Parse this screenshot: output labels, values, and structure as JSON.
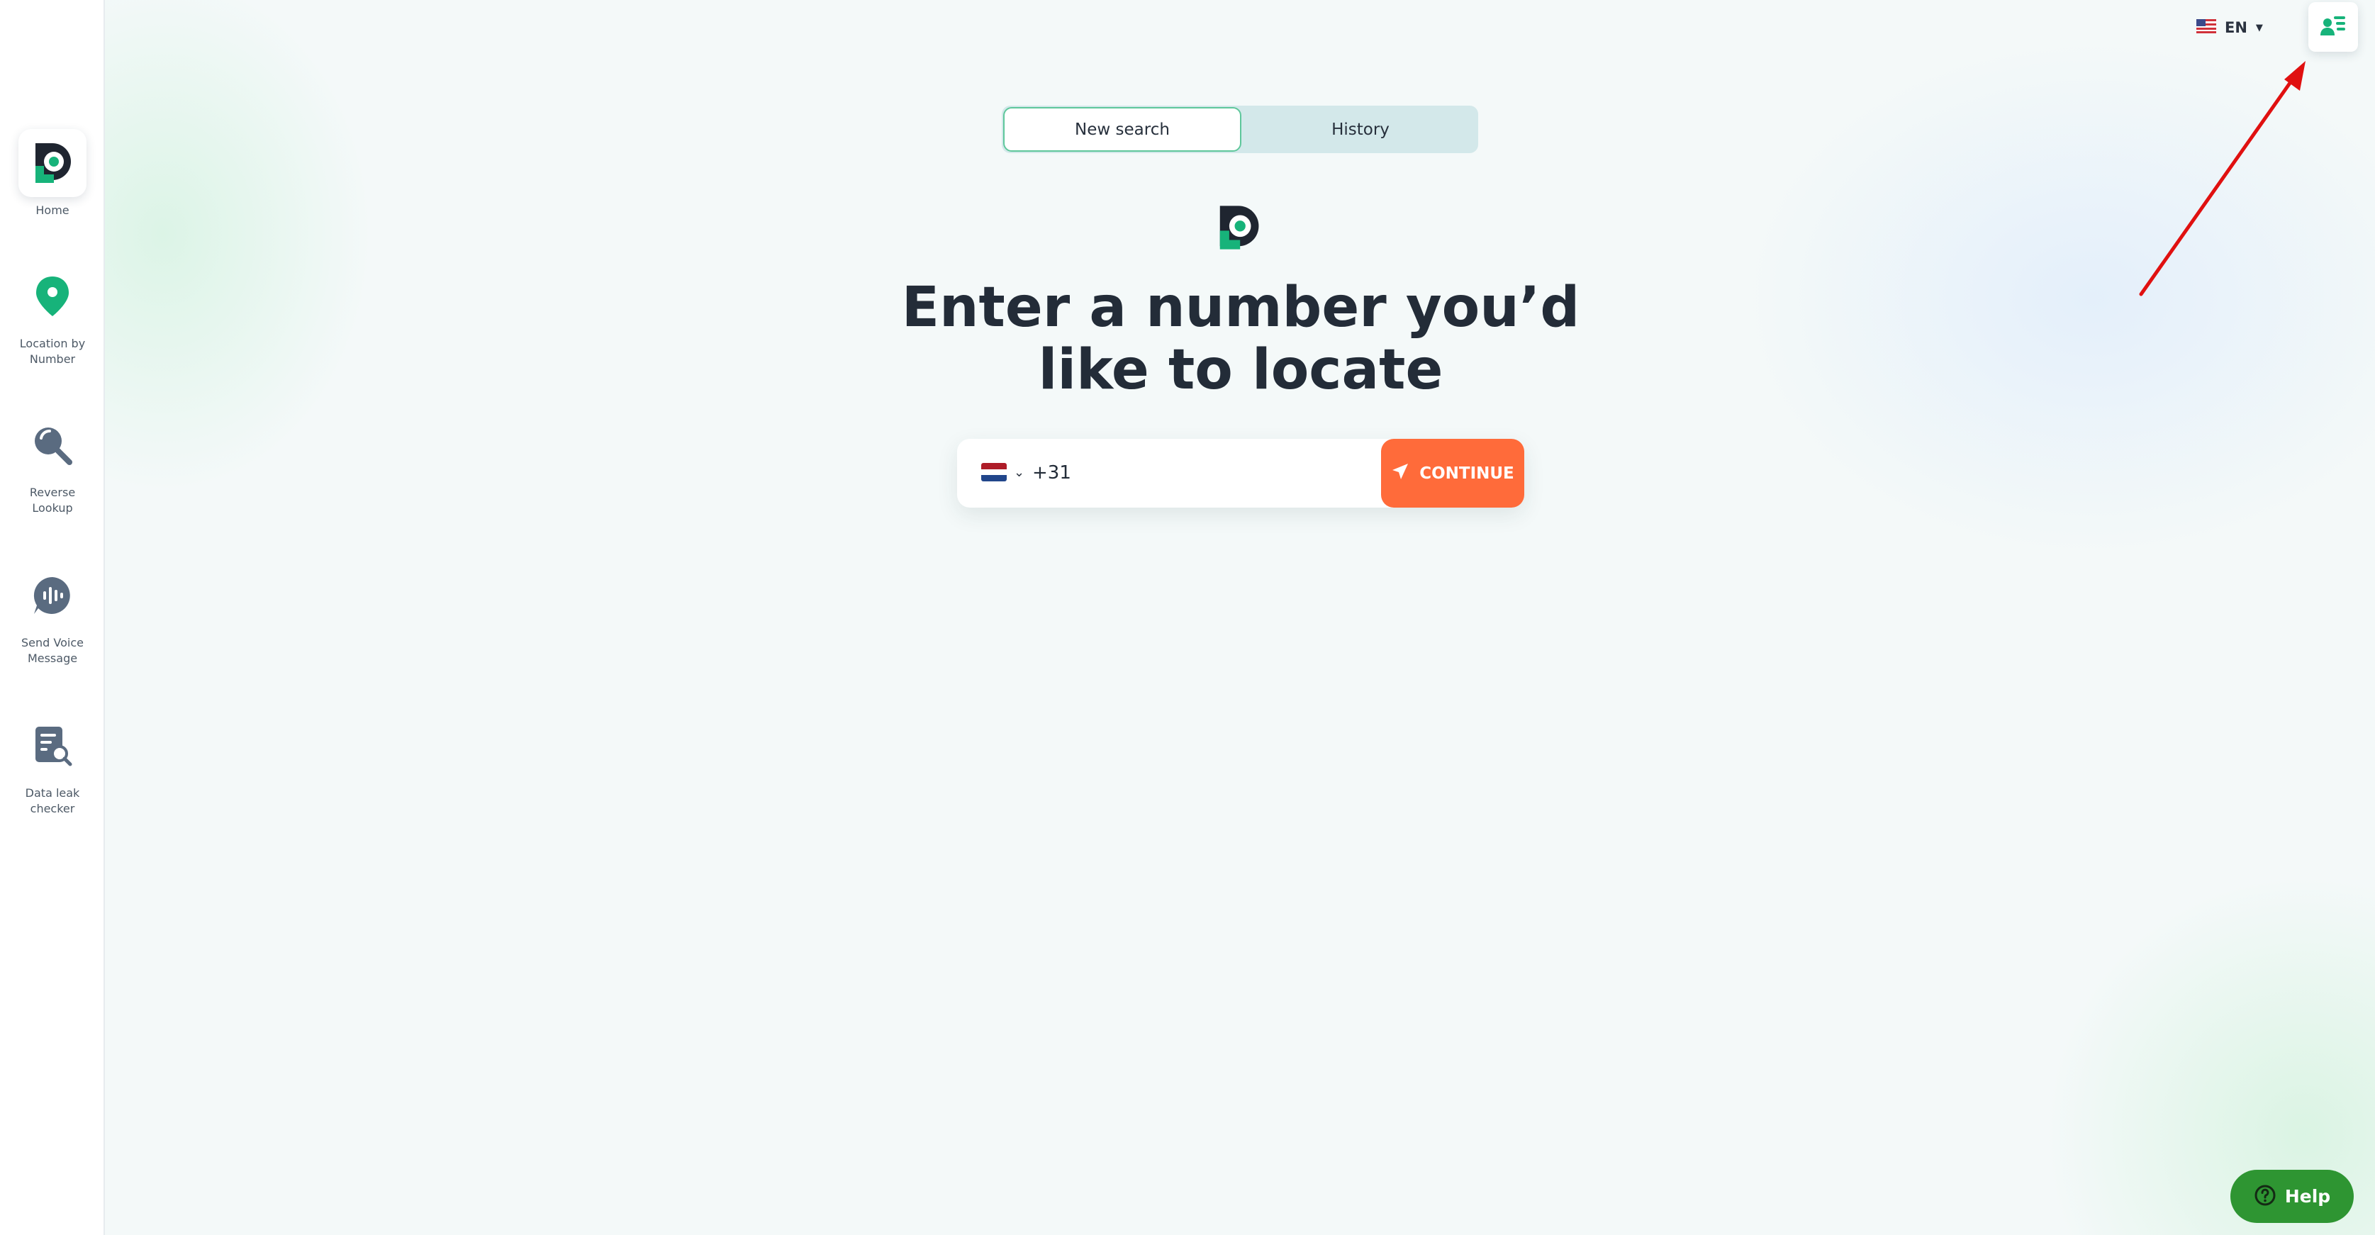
{
  "sidebar": {
    "items": [
      {
        "label": "Home",
        "icon": "home-logo-icon"
      },
      {
        "label": "Location by Number",
        "icon": "map-pin-icon"
      },
      {
        "label": "Reverse Lookup",
        "icon": "magnifier-icon"
      },
      {
        "label": "Send Voice Message",
        "icon": "voice-message-icon"
      },
      {
        "label": "Data leak checker",
        "icon": "document-search-icon"
      }
    ]
  },
  "header": {
    "language": "EN",
    "language_flag": "us-flag-icon",
    "profile_icon": "user-list-icon"
  },
  "tabs": [
    {
      "label": "New search",
      "active": true
    },
    {
      "label": "History",
      "active": false
    }
  ],
  "main": {
    "headline_line1": "Enter a number you’d",
    "headline_line2": "like to locate",
    "phone": {
      "country_flag": "netherlands-flag-icon",
      "value": "+31",
      "placeholder": ""
    },
    "continue_label": "CONTINUE"
  },
  "help": {
    "label": "Help"
  },
  "colors": {
    "brand_green": "#17b37a",
    "accent_orange": "#ff6b3a",
    "help_green": "#2e9532",
    "annotation_red": "#e01010"
  }
}
